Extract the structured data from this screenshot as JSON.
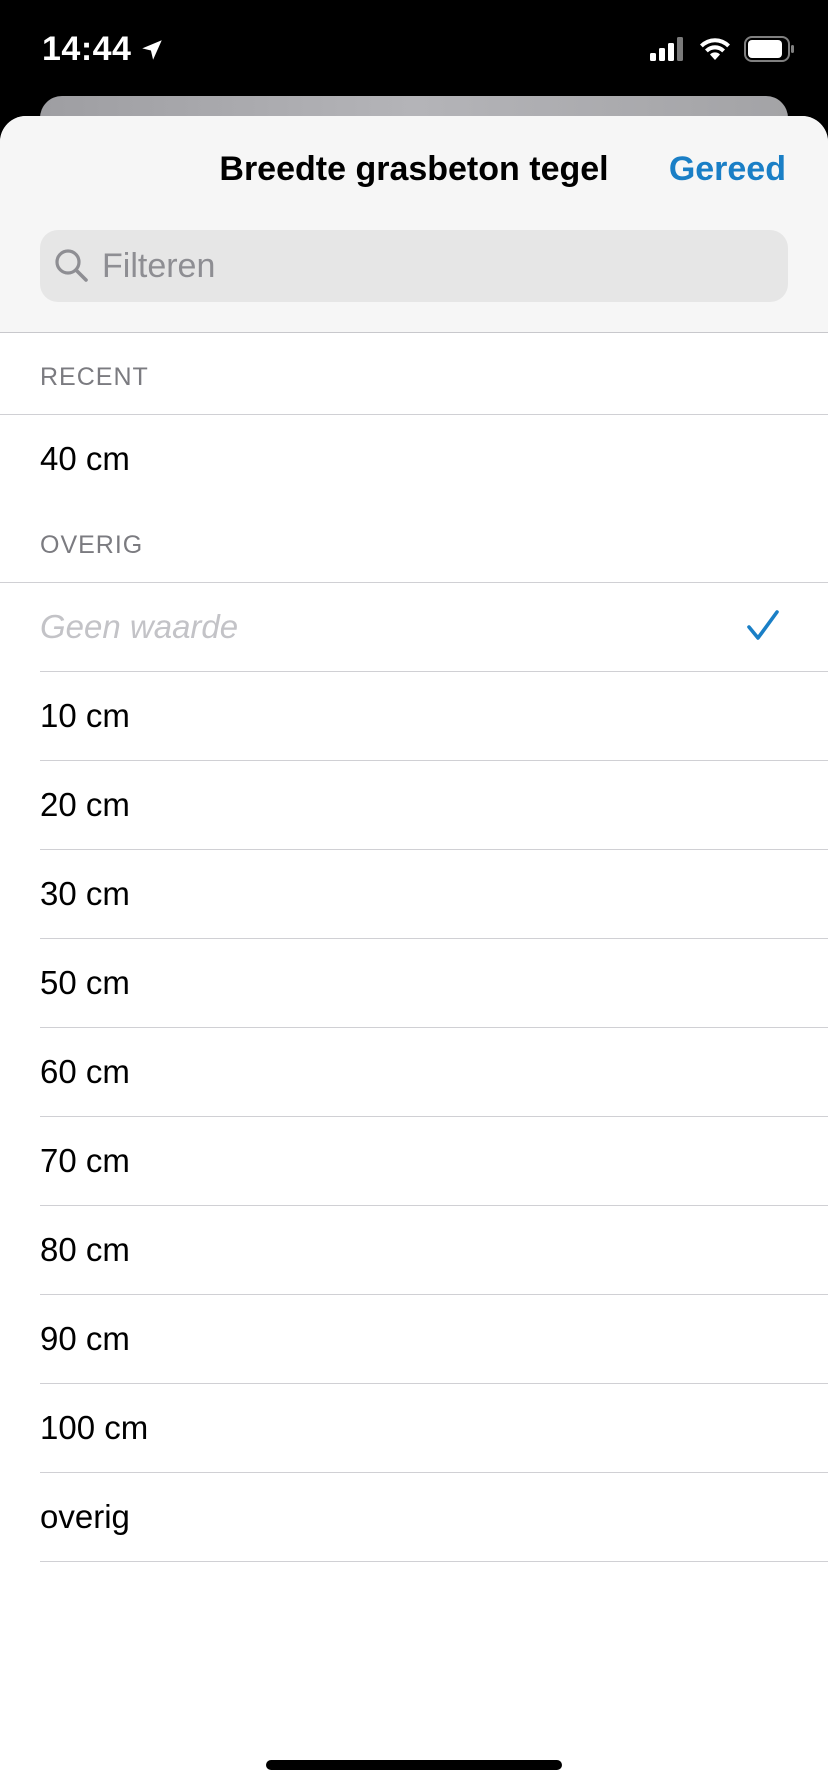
{
  "status_bar": {
    "time": "14:44"
  },
  "sheet": {
    "title": "Breedte grasbeton tegel",
    "done_label": "Gereed",
    "search": {
      "placeholder": "Filteren",
      "value": ""
    }
  },
  "sections": {
    "recent": {
      "header": "RECENT",
      "items": [
        "40 cm"
      ]
    },
    "other": {
      "header": "OVERIG",
      "no_value_label": "Geen waarde",
      "items": [
        "10 cm",
        "20 cm",
        "30 cm",
        "50 cm",
        "60 cm",
        "70 cm",
        "80 cm",
        "90 cm",
        "100 cm",
        "overig"
      ]
    }
  },
  "selected": "Geen waarde",
  "colors": {
    "accent": "#1a7fc6",
    "placeholder_text": "#c3c3c7",
    "section_header": "#7b7b80"
  }
}
